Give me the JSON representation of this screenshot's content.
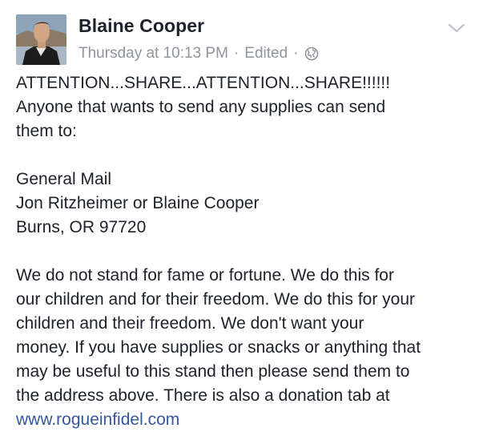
{
  "post": {
    "author": "Blaine Cooper",
    "time": "Thursday at 10:13 PM",
    "edited": "Edited",
    "separator": "·",
    "privacy_icon": "globe-icon",
    "menu_icon": "chevron-down-icon",
    "body": {
      "headline": "ATTENTION...SHARE...ATTENTION...SHARE!!!!!!",
      "intro_lines": [
        "Anyone that wants to send any supplies can send",
        "them to:"
      ],
      "address_lines": [
        "General Mail",
        "Jon Ritzheimer or Blaine Cooper",
        "Burns, OR 97720"
      ],
      "message_lines": [
        "We do not stand for fame or fortune. We do this for",
        "our children and for their freedom. We do this for your",
        "children and their freedom. We don't want your",
        "money. If you have supplies or snacks or anything that",
        "may be useful to this stand then please send them to",
        "the address above. There is also a donation tab at"
      ],
      "link": "www.rogueinfidel.com"
    }
  },
  "colors": {
    "text": "#1d2129",
    "meta": "#90949c",
    "link": "#365899"
  }
}
